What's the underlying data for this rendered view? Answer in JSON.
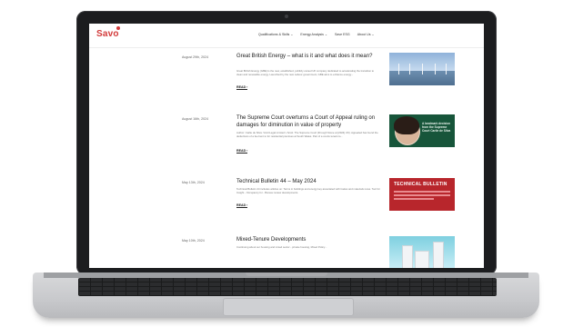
{
  "site": {
    "logo_text": "Savo",
    "nav": [
      "Qualifications & Skills ⌄",
      "Energy Analysis ⌄",
      "Save ESG",
      "About Us ⌄"
    ]
  },
  "articles": [
    {
      "date": "August 29th, 2024",
      "title": "Great British Energy – what is it and what does it mean?",
      "excerpt": "Great British Energy (GBE) is the new, established, publicly owned UK company dedicated to accelerating the transition to clean and renewable energy. Launched by the new Labour government, GBE aims to enhance energy...",
      "read": "READ ›"
    },
    {
      "date": "August 16th, 2024",
      "title": "The Supreme Court overturns a Court of Appeal ruling on damages for diminution in value of property",
      "excerpt": "Author: Carlie de Silva. Vivid Legal Limited v Scott. The Supreme Court (through Stone at [2024] UK). Appealed has found the deductions of a fee bent to for residential premises at South Wales. Part of a courts tenant to...",
      "read": "READ ›",
      "thumb_text": "A landmark decision from the Supreme Court Carlie de Silva"
    },
    {
      "date": "May 13th, 2024",
      "title": "Technical Bulletin 44 – May 2024",
      "excerpt": "Technical Bulletin 44 includes articles on: Terms in buildings and energy key associated with trades and materials news. Tool for Insight - Occupancy for - Bureau review developments.",
      "read": "READ ›",
      "thumb_title": "TECHNICAL BULLETIN"
    },
    {
      "date": "May 10th, 2024",
      "title": "Mixed-Tenure Developments",
      "excerpt": "Continuing about our housing and mixed sector - private housing, Mixed Policy...",
      "read": "READ ›"
    }
  ],
  "colors": {
    "brand": "#d23a3a",
    "laptop_bezel": "#1c1d1f",
    "laptop_body": "#c8c9cc"
  }
}
